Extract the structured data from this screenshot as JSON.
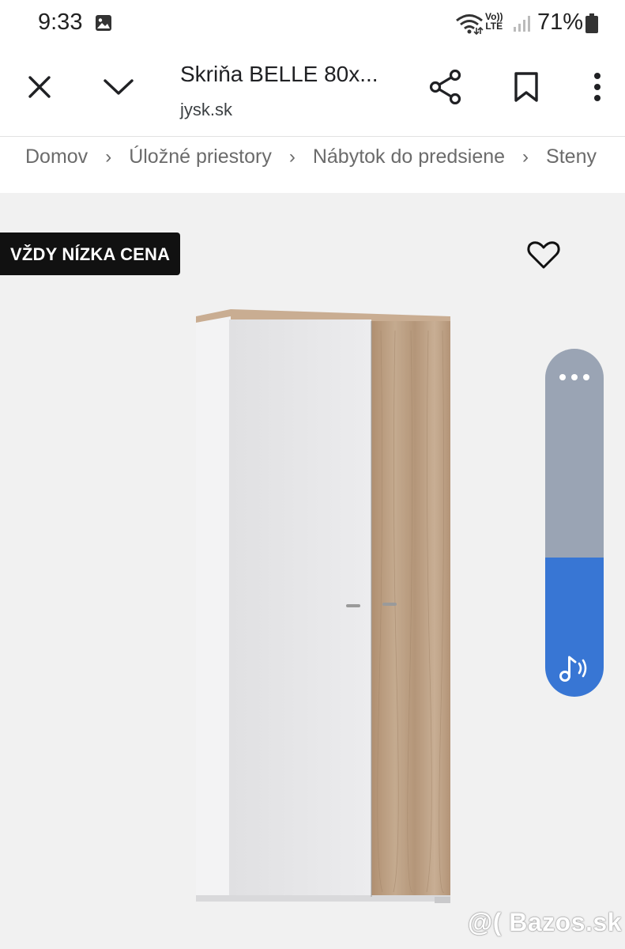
{
  "status_bar": {
    "time": "9:33",
    "volte_line1": "Vo))",
    "volte_line2": "LTE",
    "battery": "71%"
  },
  "header": {
    "title": "Skriňa BELLE 80x...",
    "domain": "jysk.sk"
  },
  "breadcrumb": [
    {
      "label": "Domov"
    },
    {
      "label": "Úložné priestory"
    },
    {
      "label": "Nábytok do predsiene"
    },
    {
      "label": "Steny"
    }
  ],
  "breadcrumb_separator": "›",
  "product": {
    "badge": "VŽDY NÍZKA CENA"
  },
  "watermark": "@( Bazos.sk",
  "colors": {
    "badge_bg": "#111111",
    "audio_widget_top": "#9aa4b4",
    "audio_widget_bottom": "#3876d4",
    "oak": "#b99d83",
    "white_door": "#e6e6e8"
  },
  "icons": {
    "status_image": "image-icon",
    "wifi": "wifi-icon",
    "signal": "signal-icon",
    "battery": "battery-icon",
    "close": "close-icon",
    "collapse": "chevron-down-icon",
    "share": "share-icon",
    "bookmark": "bookmark-icon",
    "more": "more-vert-icon",
    "wishlist": "heart-icon",
    "audio_more": "more-horiz-icon",
    "audio": "music-note-icon"
  }
}
